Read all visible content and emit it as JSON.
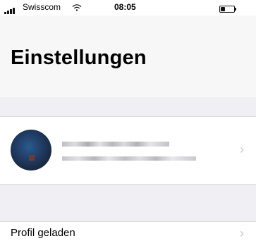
{
  "status_bar": {
    "carrier": "Swisscom",
    "time": "08:05",
    "battery_level": 0.35
  },
  "screen": {
    "title": "Einstellungen"
  },
  "profile": {
    "avatar_icon": "profile-avatar-icon"
  },
  "settings": {
    "profile_loaded_label": "Profil geladen"
  },
  "colors": {
    "background": "#efeff4",
    "chevron": "#c7c7cc"
  }
}
